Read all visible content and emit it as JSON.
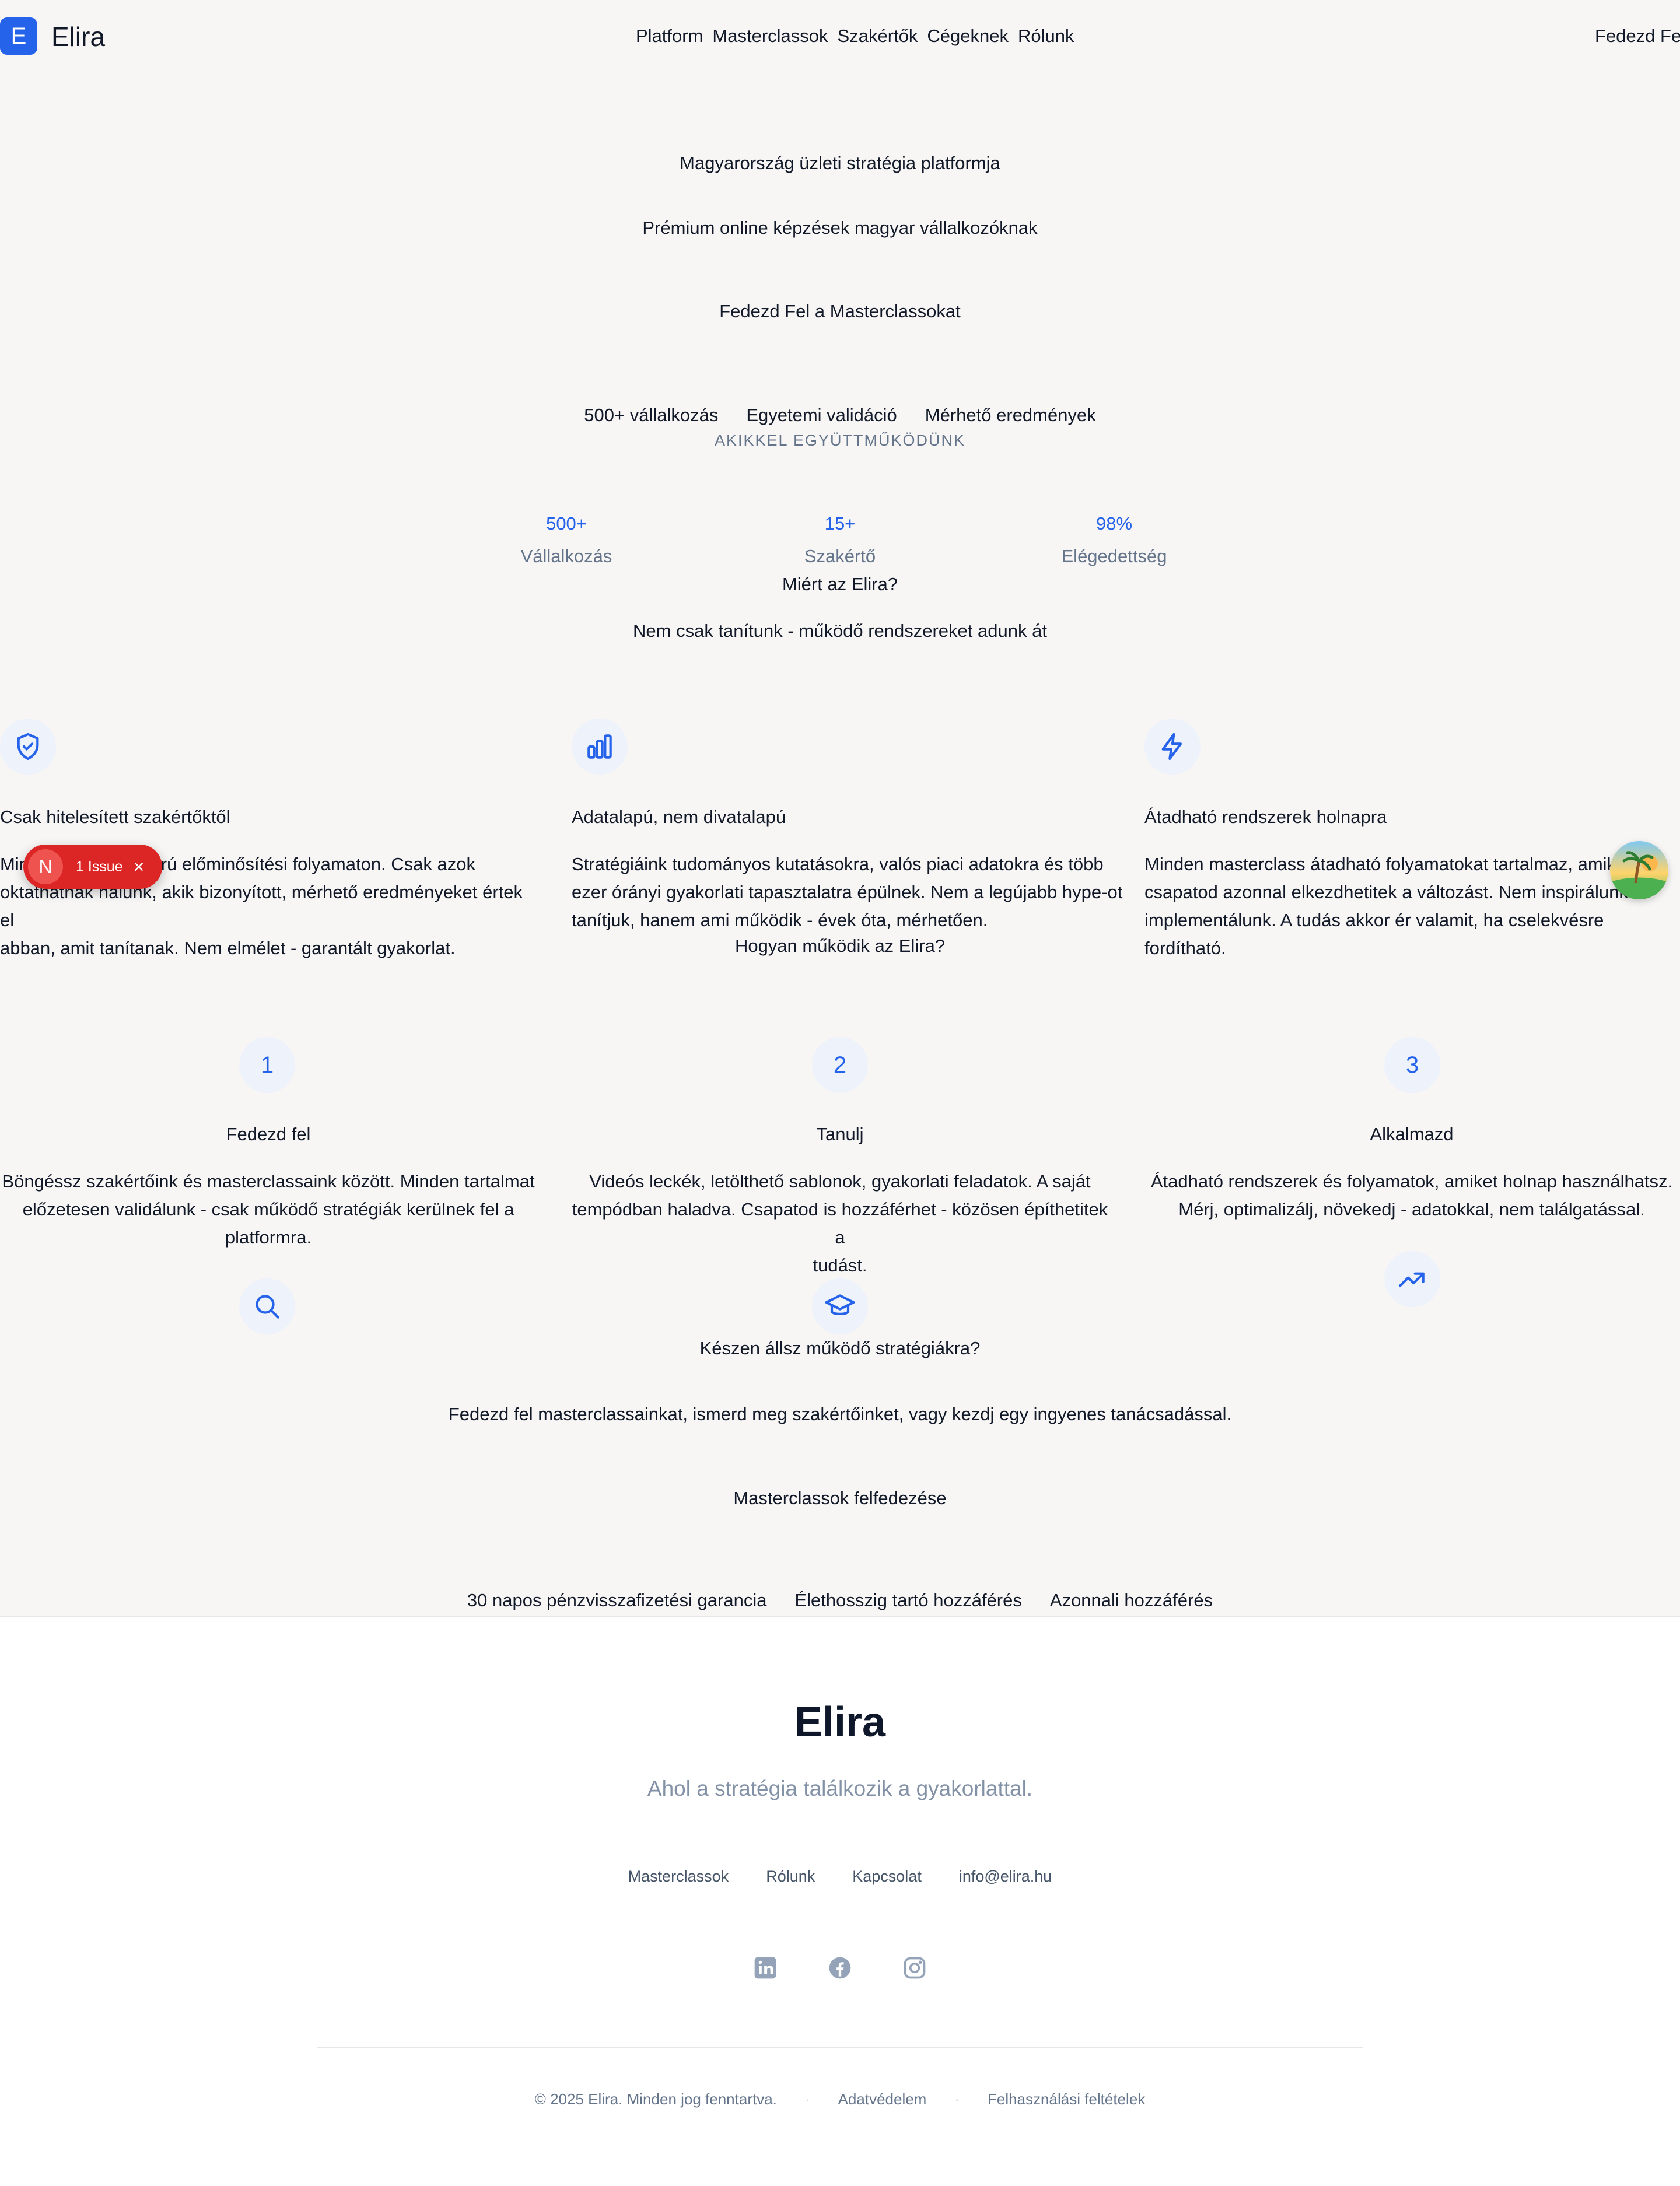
{
  "header": {
    "logo_letter": "E",
    "brand": "Elira",
    "nav": [
      "Platform",
      "Masterclassok",
      "Szakértők",
      "Cégeknek",
      "Rólunk"
    ],
    "cta": "Fedezd Fel"
  },
  "hero": {
    "eyebrow": "Magyarország üzleti stratégia platformja",
    "subtitle": "Prémium online képzések magyar vállalkozóknak",
    "cta": "Fedezd Fel a Masterclassokat",
    "trust": [
      "500+ vállalkozás",
      "Egyetemi validáció",
      "Mérhető eredmények"
    ]
  },
  "partners": {
    "heading": "AKIKKEL EGYÜTTMŰKÖDÜNK"
  },
  "stats": [
    {
      "value": "500+",
      "label": "Vállalkozás"
    },
    {
      "value": "15+",
      "label": "Szakértő"
    },
    {
      "value": "98%",
      "label": "Elégedettség"
    }
  ],
  "why": {
    "title": "Miért az Elira?",
    "subtitle": "Nem csak tanítunk - működő rendszereket adunk át",
    "features": [
      {
        "icon": "shield-check-icon",
        "title": "Csak hitelesített szakértőktől",
        "lines": [
          "Minden oktató szigorú előminősítési folyamaton. Csak azok",
          "oktathatnak nálunk, akik bizonyított, mérhető eredményeket értek el",
          "abban, amit tanítanak. Nem elmélet - garantált gyakorlat."
        ]
      },
      {
        "icon": "bar-chart-icon",
        "title": "Adatalapú, nem divatalapú",
        "lines": [
          "Stratégiáink tudományos kutatásokra, valós piaci adatokra és több",
          "ezer órányi gyakorlati tapasztalatra épülnek. Nem a legújabb hype-ot",
          "tanítjuk, hanem ami működik - évek óta, mérhetően."
        ]
      },
      {
        "icon": "lightning-icon",
        "title": "Átadható rendszerek holnapra",
        "lines": [
          "Minden masterclass átadható folyamatokat tartalmaz, amikkel",
          "csapatod azonnal elkezdhetitek a változást. Nem inspirálunk -",
          "implementálunk. A tudás akkor ér valamit, ha cselekvésre fordítható."
        ]
      }
    ]
  },
  "how": {
    "title": "Hogyan működik az Elira?",
    "steps": [
      {
        "number": "1",
        "title": "Fedezd fel",
        "lines": [
          "Böngéssz szakértőink és masterclassaink között. Minden tartalmat",
          "előzetesen validálunk - csak működő stratégiák kerülnek fel a",
          "platformra."
        ],
        "icon": "search-icon"
      },
      {
        "number": "2",
        "title": "Tanulj",
        "lines": [
          "Videós leckék, letölthető sablonok, gyakorlati feladatok. A saját",
          "tempódban haladva. Csapatod is hozzáférhet - közösen építhetitek a",
          "tudást."
        ],
        "icon": "graduation-cap-icon"
      },
      {
        "number": "3",
        "title": "Alkalmazd",
        "lines": [
          "Átadható rendszerek és folyamatok, amiket holnap használhatsz.",
          "Mérj, optimalizálj, növekedj - adatokkal, nem találgatással."
        ],
        "icon": "trending-up-icon"
      }
    ]
  },
  "cta_section": {
    "title": "Készen állsz működő stratégiákra?",
    "subtitle": "Fedezd fel masterclassainkat, ismerd meg szakértőinket, vagy kezdj egy ingyenes tanácsadással.",
    "button": "Masterclassok felfedezése",
    "guarantees": [
      "30 napos pénzvisszafizetési garancia",
      "Élethosszig tartó hozzáférés",
      "Azonnali hozzáférés"
    ]
  },
  "footer": {
    "brand": "Elira",
    "tagline": "Ahol a stratégia találkozik a gyakorlattal.",
    "links": [
      "Masterclassok",
      "Rólunk",
      "Kapcsolat",
      "info@elira.hu"
    ],
    "social": [
      "linkedin-icon",
      "facebook-icon",
      "instagram-icon"
    ],
    "copyright": "© 2025 Elira. Minden jog fenntartva.",
    "separator": "·",
    "legal": [
      "Adatvédelem",
      "Felhasználási feltételek"
    ]
  },
  "dev_overlay": {
    "badge_letter": "N",
    "issues": "1 Issue",
    "close": "×"
  },
  "colors": {
    "accent": "#2563eb",
    "background": "#f7f6f5",
    "footer_bg": "#ffffff",
    "issue_red": "#dc2626"
  }
}
